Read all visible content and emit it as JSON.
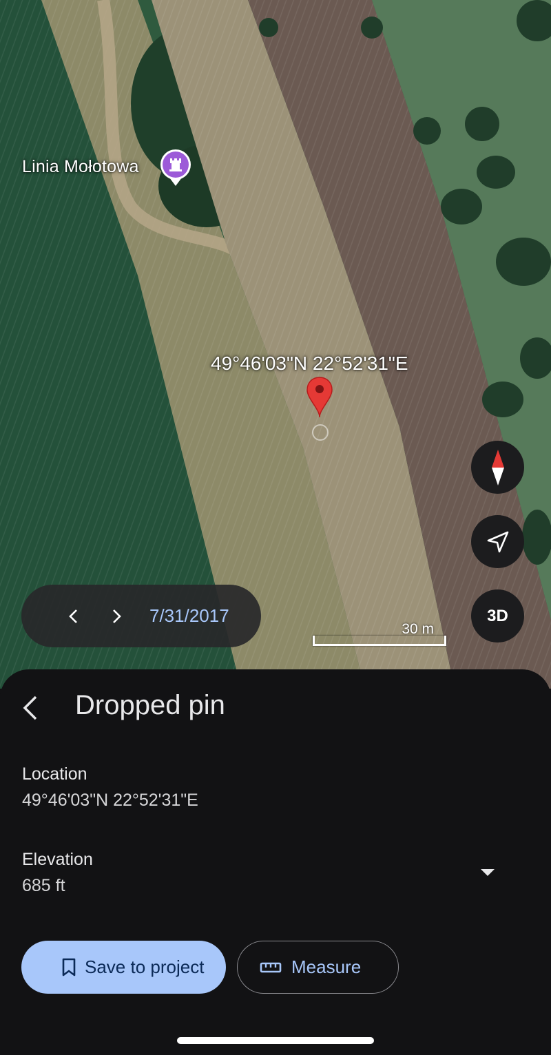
{
  "map": {
    "poi_label": "Linia Mołotowa",
    "poi_icon": "castle-icon",
    "pin_coordinates": "49°46'03\"N 22°52'31\"E",
    "pin_icon": "map-pin-icon",
    "scale_label": "30 m",
    "buttons": {
      "compass": "compass-icon",
      "my_location": "navigation-arrow-icon",
      "three_d": "3D"
    },
    "date_bar": {
      "prev_icon": "chevron-left-icon",
      "next_icon": "chevron-right-icon",
      "date": "7/31/2017"
    }
  },
  "sheet": {
    "title": "Dropped pin",
    "location_label": "Location",
    "location_value": "49°46'03\"N 22°52'31\"E",
    "elevation_label": "Elevation",
    "elevation_value": "685 ft",
    "save_button_label": "Save to project",
    "measure_button_label": "Measure"
  },
  "colors": {
    "accent": "#a8c7fa",
    "pin_red": "#e53935",
    "poi_purple": "#9c5ad8",
    "sheet_background": "#121214"
  }
}
